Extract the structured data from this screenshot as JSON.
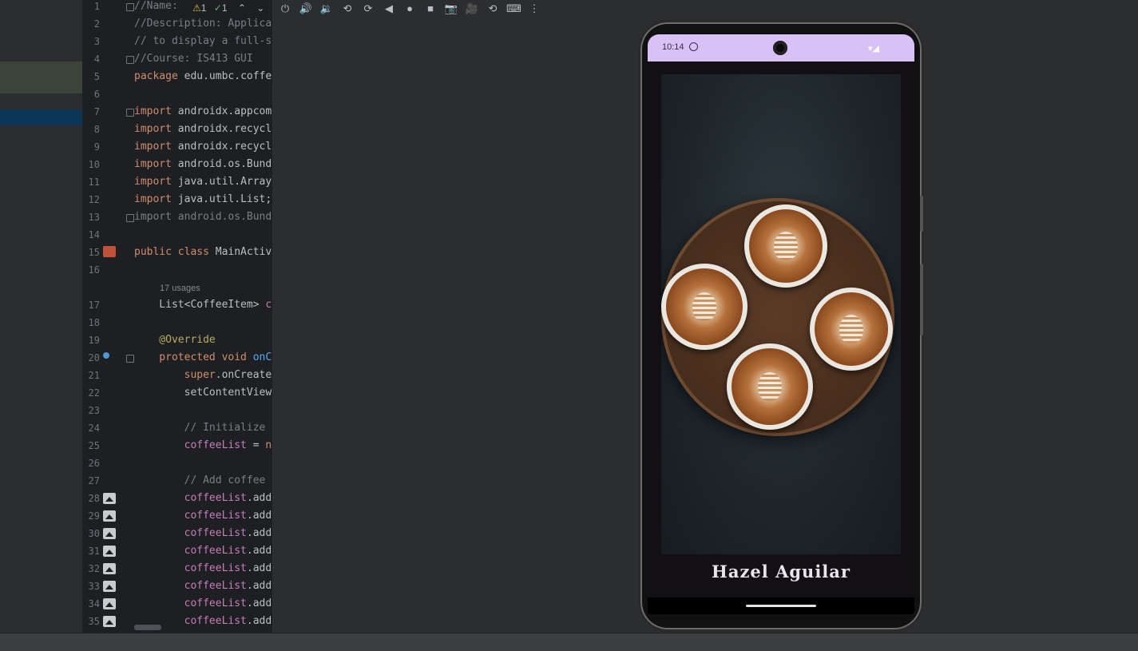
{
  "editor": {
    "warnings": "1",
    "checks": "1",
    "usages": "17 usages",
    "lines": [
      {
        "n": "1",
        "segs": [
          {
            "t": "//Name: ",
            "c": "cm"
          }
        ]
      },
      {
        "n": "2",
        "segs": [
          {
            "t": "//Description: Applica",
            "c": "cm"
          }
        ]
      },
      {
        "n": "3",
        "segs": [
          {
            "t": "// to display a full-s",
            "c": "cm"
          }
        ]
      },
      {
        "n": "4",
        "segs": [
          {
            "t": "//Course: IS413 GUI",
            "c": "cm"
          }
        ]
      },
      {
        "n": "5",
        "segs": [
          {
            "t": "package ",
            "c": "kw"
          },
          {
            "t": "edu.umbc.coffe",
            "c": ""
          }
        ]
      },
      {
        "n": "6",
        "segs": []
      },
      {
        "n": "7",
        "segs": [
          {
            "t": "import ",
            "c": "kw"
          },
          {
            "t": "androidx.appcom",
            "c": ""
          }
        ]
      },
      {
        "n": "8",
        "segs": [
          {
            "t": "import ",
            "c": "kw"
          },
          {
            "t": "androidx.recycl",
            "c": ""
          }
        ]
      },
      {
        "n": "9",
        "segs": [
          {
            "t": "import ",
            "c": "kw"
          },
          {
            "t": "androidx.recycl",
            "c": ""
          }
        ]
      },
      {
        "n": "10",
        "segs": [
          {
            "t": "import ",
            "c": "kw"
          },
          {
            "t": "android.os.Bund",
            "c": ""
          }
        ]
      },
      {
        "n": "11",
        "segs": [
          {
            "t": "import ",
            "c": "kw"
          },
          {
            "t": "java.util.Array",
            "c": ""
          }
        ]
      },
      {
        "n": "12",
        "segs": [
          {
            "t": "import ",
            "c": "kw"
          },
          {
            "t": "java.util.List;",
            "c": ""
          }
        ]
      },
      {
        "n": "13",
        "segs": [
          {
            "t": "import android.os.Bund",
            "c": "cm"
          }
        ]
      },
      {
        "n": "14",
        "segs": []
      },
      {
        "n": "15",
        "segs": [
          {
            "t": "public class ",
            "c": "kw"
          },
          {
            "t": "MainActiv",
            "c": ""
          }
        ]
      },
      {
        "n": "16",
        "segs": []
      },
      {
        "n": "17",
        "segs": [
          {
            "t": "    List<CoffeeItem> ",
            "c": ""
          },
          {
            "t": "c",
            "c": "fld"
          }
        ]
      },
      {
        "n": "18",
        "segs": []
      },
      {
        "n": "19",
        "segs": [
          {
            "t": "    @Override",
            "c": "an"
          }
        ]
      },
      {
        "n": "20",
        "segs": [
          {
            "t": "    protected void ",
            "c": "kw"
          },
          {
            "t": "onC",
            "c": "fn"
          }
        ]
      },
      {
        "n": "21",
        "segs": [
          {
            "t": "        super",
            "c": "kw"
          },
          {
            "t": ".onCreate",
            "c": ""
          }
        ]
      },
      {
        "n": "22",
        "segs": [
          {
            "t": "        setContentView",
            "c": ""
          }
        ]
      },
      {
        "n": "23",
        "segs": []
      },
      {
        "n": "24",
        "segs": [
          {
            "t": "        // Initialize ",
            "c": "cm"
          }
        ]
      },
      {
        "n": "25",
        "segs": [
          {
            "t": "        coffeeList",
            "c": "fld"
          },
          {
            "t": " = ",
            "c": ""
          },
          {
            "t": "n",
            "c": "kw"
          }
        ]
      },
      {
        "n": "26",
        "segs": []
      },
      {
        "n": "27",
        "segs": [
          {
            "t": "        // Add coffee ",
            "c": "cm"
          }
        ]
      },
      {
        "n": "28",
        "segs": [
          {
            "t": "        coffeeList",
            "c": "fld"
          },
          {
            "t": ".add",
            "c": ""
          }
        ]
      },
      {
        "n": "29",
        "segs": [
          {
            "t": "        coffeeList",
            "c": "fld"
          },
          {
            "t": ".add",
            "c": ""
          }
        ]
      },
      {
        "n": "30",
        "segs": [
          {
            "t": "        coffeeList",
            "c": "fld"
          },
          {
            "t": ".add",
            "c": ""
          }
        ]
      },
      {
        "n": "31",
        "segs": [
          {
            "t": "        coffeeList",
            "c": "fld"
          },
          {
            "t": ".add",
            "c": ""
          }
        ]
      },
      {
        "n": "32",
        "segs": [
          {
            "t": "        coffeeList",
            "c": "fld"
          },
          {
            "t": ".add",
            "c": ""
          }
        ]
      },
      {
        "n": "33",
        "segs": [
          {
            "t": "        coffeeList",
            "c": "fld"
          },
          {
            "t": ".add",
            "c": ""
          }
        ]
      },
      {
        "n": "34",
        "segs": [
          {
            "t": "        coffeeList",
            "c": "fld"
          },
          {
            "t": ".add",
            "c": ""
          }
        ]
      },
      {
        "n": "35",
        "segs": [
          {
            "t": "        coffeeList",
            "c": "fld"
          },
          {
            "t": ".add",
            "c": ""
          }
        ]
      }
    ]
  },
  "toolbar": {
    "icons": [
      "power-icon",
      "volume-up-icon",
      "volume-down-icon",
      "rotate-left-icon",
      "rotate-right-icon",
      "back-icon",
      "home-icon",
      "overview-icon",
      "screenshot-icon",
      "screen-record-icon",
      "snapshot-icon",
      "keyboard-icon",
      "more-icon"
    ],
    "glyphs": [
      "⏻",
      "🔊",
      "🔉",
      "⟲",
      "⟳",
      "◀",
      "●",
      "■",
      "📷",
      "🎥",
      "⟲",
      "⌨",
      "⋮"
    ]
  },
  "device": {
    "time": "10:14",
    "coffee_name": "Hazel Aguilar",
    "status_color": "#d8c2f5"
  }
}
